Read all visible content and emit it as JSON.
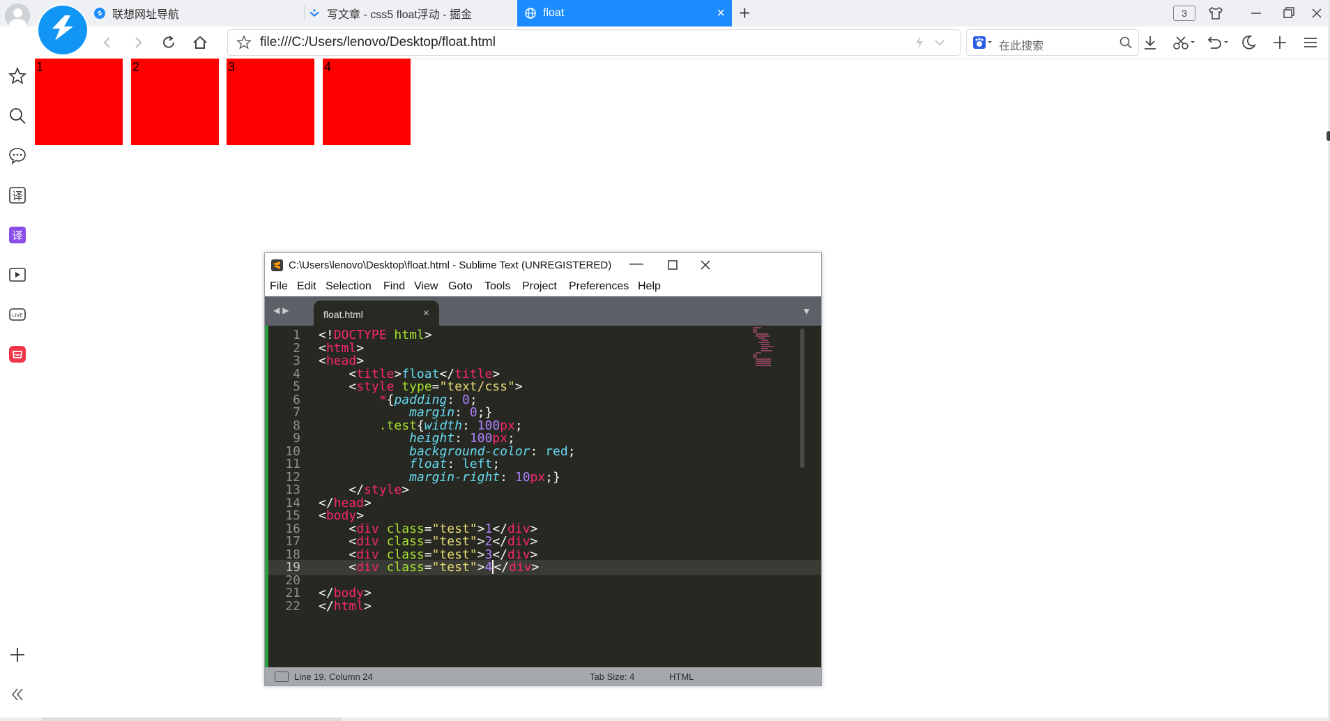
{
  "browser": {
    "tabs": [
      {
        "title": "联想网址导航",
        "active": false
      },
      {
        "title": "写文章 - css5 float浮动 - 掘金",
        "active": false
      },
      {
        "title": "float",
        "active": true
      }
    ],
    "window_count": "3",
    "url": "file:///C:/Users/lenovo/Desktop/float.html",
    "search_placeholder": "在此搜索",
    "accent_color": "#1a8cff"
  },
  "sidebar": {
    "icons": [
      "star-icon",
      "search-icon",
      "chat-icon",
      "translate-icon",
      "translate-purple-icon",
      "video-icon",
      "live-icon",
      "shop-icon",
      "add-icon",
      "collapse-icon"
    ]
  },
  "page": {
    "boxes": [
      "1",
      "2",
      "3",
      "4"
    ],
    "box_color": "#ff0000"
  },
  "sublime": {
    "title": "C:\\Users\\lenovo\\Desktop\\float.html - Sublime Text (UNREGISTERED)",
    "menu": [
      "File",
      "Edit",
      "Selection",
      "Find",
      "View",
      "Goto",
      "Tools",
      "Project",
      "Preferences",
      "Help"
    ],
    "tab_name": "float.html",
    "status_position": "Line 19, Column 24",
    "status_tabsize": "Tab Size: 4",
    "status_syntax": "HTML",
    "current_line": 19,
    "code_lines": [
      "<!DOCTYPE html>",
      "<html>",
      "<head>",
      "    <title>float</title>",
      "    <style type=\"text/css\">",
      "        *{padding: 0;",
      "            margin: 0;}",
      "        .test{width: 100px;",
      "            height: 100px;",
      "            background-color: red;",
      "            float: left;",
      "            margin-right: 10px;}",
      "    </style>",
      "</head>",
      "<body>",
      "    <div class=\"test\">1</div>",
      "    <div class=\"test\">2</div>",
      "    <div class=\"test\">3</div>",
      "    <div class=\"test\">4</div>",
      "",
      "</body>",
      "</html>"
    ]
  }
}
